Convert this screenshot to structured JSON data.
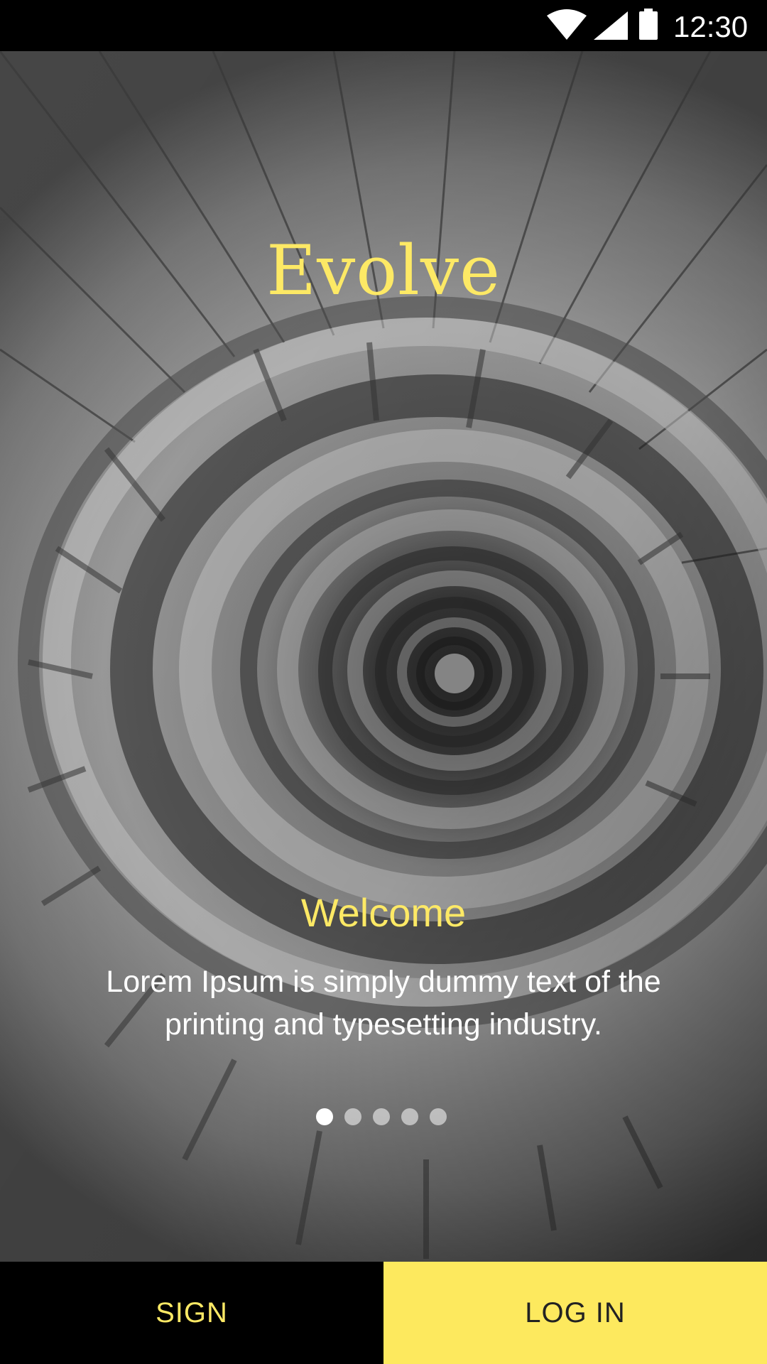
{
  "status_bar": {
    "time": "12:30",
    "icons": [
      "wifi-icon",
      "cellular-signal-icon",
      "battery-icon"
    ]
  },
  "hero": {
    "background_image": "spiral-staircase-photo",
    "app_name": "Evolve",
    "slide": {
      "title": "Welcome",
      "body": "Lorem Ipsum is simply dummy text of the printing and typesetting industry."
    },
    "pager": {
      "total": 5,
      "active_index": 0
    }
  },
  "actions": {
    "sign_label": "SIGN",
    "login_label": "LOG IN"
  },
  "colors": {
    "accent": "#fde965",
    "login_button_bg": "#fde95e",
    "sign_button_bg": "#000000",
    "status_bar_bg": "#000000"
  }
}
